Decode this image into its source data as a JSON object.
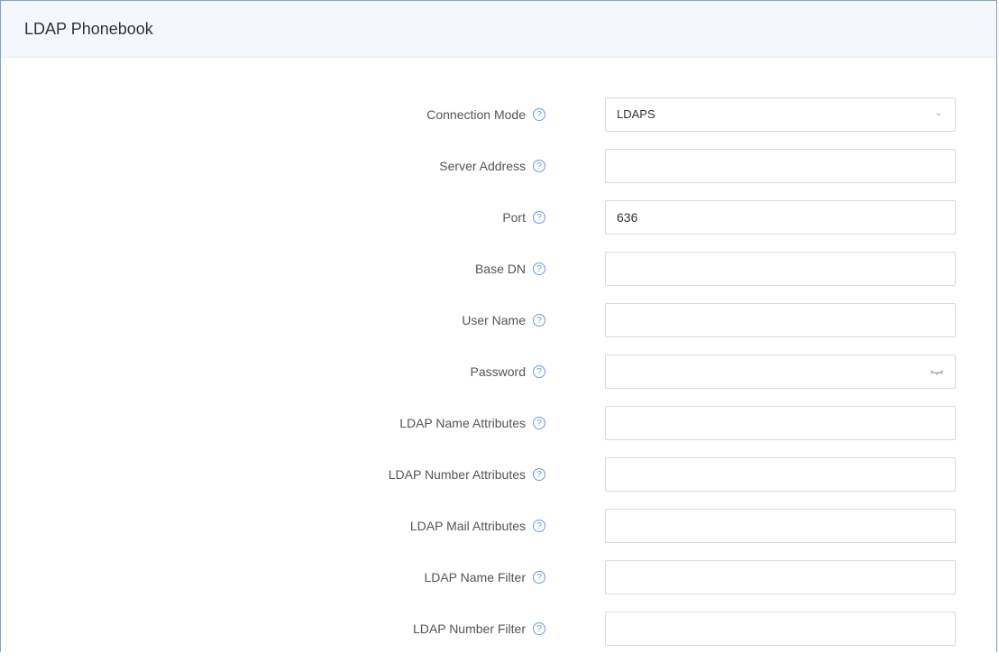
{
  "panel": {
    "title": "LDAP Phonebook"
  },
  "fields": [
    {
      "label": "Connection Mode",
      "type": "select",
      "value": "LDAPS"
    },
    {
      "label": "Server Address",
      "type": "text",
      "value": ""
    },
    {
      "label": "Port",
      "type": "text",
      "value": "636"
    },
    {
      "label": "Base DN",
      "type": "text",
      "value": ""
    },
    {
      "label": "User Name",
      "type": "text",
      "value": ""
    },
    {
      "label": "Password",
      "type": "password",
      "value": ""
    },
    {
      "label": "LDAP Name Attributes",
      "type": "text",
      "value": ""
    },
    {
      "label": "LDAP Number Attributes",
      "type": "text",
      "value": ""
    },
    {
      "label": "LDAP Mail Attributes",
      "type": "text",
      "value": ""
    },
    {
      "label": "LDAP Name Filter",
      "type": "text",
      "value": ""
    },
    {
      "label": "LDAP Number Filter",
      "type": "text",
      "value": ""
    }
  ],
  "icons": {
    "help": "help-icon",
    "dropdown": "chevron-down-icon",
    "password_toggle": "eye-closed-icon"
  },
  "colors": {
    "border_accent": "#7ba3d6",
    "help_icon": "#6b9bd8",
    "header_bg": "#f4f7fb"
  }
}
